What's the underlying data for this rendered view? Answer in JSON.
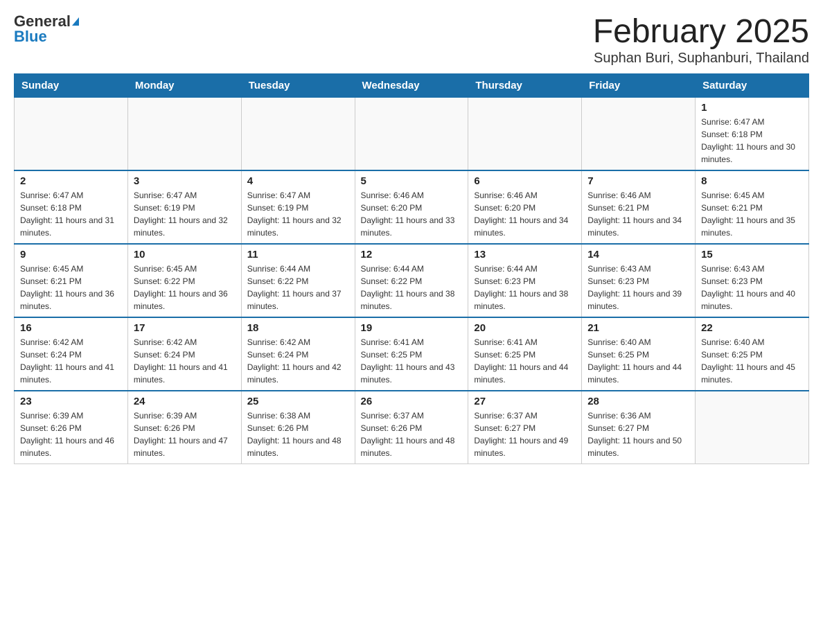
{
  "header": {
    "logo_general": "General",
    "logo_blue": "Blue",
    "title": "February 2025",
    "subtitle": "Suphan Buri, Suphanburi, Thailand"
  },
  "weekdays": [
    "Sunday",
    "Monday",
    "Tuesday",
    "Wednesday",
    "Thursday",
    "Friday",
    "Saturday"
  ],
  "weeks": [
    [
      {
        "day": "",
        "info": ""
      },
      {
        "day": "",
        "info": ""
      },
      {
        "day": "",
        "info": ""
      },
      {
        "day": "",
        "info": ""
      },
      {
        "day": "",
        "info": ""
      },
      {
        "day": "",
        "info": ""
      },
      {
        "day": "1",
        "info": "Sunrise: 6:47 AM\nSunset: 6:18 PM\nDaylight: 11 hours and 30 minutes."
      }
    ],
    [
      {
        "day": "2",
        "info": "Sunrise: 6:47 AM\nSunset: 6:18 PM\nDaylight: 11 hours and 31 minutes."
      },
      {
        "day": "3",
        "info": "Sunrise: 6:47 AM\nSunset: 6:19 PM\nDaylight: 11 hours and 32 minutes."
      },
      {
        "day": "4",
        "info": "Sunrise: 6:47 AM\nSunset: 6:19 PM\nDaylight: 11 hours and 32 minutes."
      },
      {
        "day": "5",
        "info": "Sunrise: 6:46 AM\nSunset: 6:20 PM\nDaylight: 11 hours and 33 minutes."
      },
      {
        "day": "6",
        "info": "Sunrise: 6:46 AM\nSunset: 6:20 PM\nDaylight: 11 hours and 34 minutes."
      },
      {
        "day": "7",
        "info": "Sunrise: 6:46 AM\nSunset: 6:21 PM\nDaylight: 11 hours and 34 minutes."
      },
      {
        "day": "8",
        "info": "Sunrise: 6:45 AM\nSunset: 6:21 PM\nDaylight: 11 hours and 35 minutes."
      }
    ],
    [
      {
        "day": "9",
        "info": "Sunrise: 6:45 AM\nSunset: 6:21 PM\nDaylight: 11 hours and 36 minutes."
      },
      {
        "day": "10",
        "info": "Sunrise: 6:45 AM\nSunset: 6:22 PM\nDaylight: 11 hours and 36 minutes."
      },
      {
        "day": "11",
        "info": "Sunrise: 6:44 AM\nSunset: 6:22 PM\nDaylight: 11 hours and 37 minutes."
      },
      {
        "day": "12",
        "info": "Sunrise: 6:44 AM\nSunset: 6:22 PM\nDaylight: 11 hours and 38 minutes."
      },
      {
        "day": "13",
        "info": "Sunrise: 6:44 AM\nSunset: 6:23 PM\nDaylight: 11 hours and 38 minutes."
      },
      {
        "day": "14",
        "info": "Sunrise: 6:43 AM\nSunset: 6:23 PM\nDaylight: 11 hours and 39 minutes."
      },
      {
        "day": "15",
        "info": "Sunrise: 6:43 AM\nSunset: 6:23 PM\nDaylight: 11 hours and 40 minutes."
      }
    ],
    [
      {
        "day": "16",
        "info": "Sunrise: 6:42 AM\nSunset: 6:24 PM\nDaylight: 11 hours and 41 minutes."
      },
      {
        "day": "17",
        "info": "Sunrise: 6:42 AM\nSunset: 6:24 PM\nDaylight: 11 hours and 41 minutes."
      },
      {
        "day": "18",
        "info": "Sunrise: 6:42 AM\nSunset: 6:24 PM\nDaylight: 11 hours and 42 minutes."
      },
      {
        "day": "19",
        "info": "Sunrise: 6:41 AM\nSunset: 6:25 PM\nDaylight: 11 hours and 43 minutes."
      },
      {
        "day": "20",
        "info": "Sunrise: 6:41 AM\nSunset: 6:25 PM\nDaylight: 11 hours and 44 minutes."
      },
      {
        "day": "21",
        "info": "Sunrise: 6:40 AM\nSunset: 6:25 PM\nDaylight: 11 hours and 44 minutes."
      },
      {
        "day": "22",
        "info": "Sunrise: 6:40 AM\nSunset: 6:25 PM\nDaylight: 11 hours and 45 minutes."
      }
    ],
    [
      {
        "day": "23",
        "info": "Sunrise: 6:39 AM\nSunset: 6:26 PM\nDaylight: 11 hours and 46 minutes."
      },
      {
        "day": "24",
        "info": "Sunrise: 6:39 AM\nSunset: 6:26 PM\nDaylight: 11 hours and 47 minutes."
      },
      {
        "day": "25",
        "info": "Sunrise: 6:38 AM\nSunset: 6:26 PM\nDaylight: 11 hours and 48 minutes."
      },
      {
        "day": "26",
        "info": "Sunrise: 6:37 AM\nSunset: 6:26 PM\nDaylight: 11 hours and 48 minutes."
      },
      {
        "day": "27",
        "info": "Sunrise: 6:37 AM\nSunset: 6:27 PM\nDaylight: 11 hours and 49 minutes."
      },
      {
        "day": "28",
        "info": "Sunrise: 6:36 AM\nSunset: 6:27 PM\nDaylight: 11 hours and 50 minutes."
      },
      {
        "day": "",
        "info": ""
      }
    ]
  ]
}
